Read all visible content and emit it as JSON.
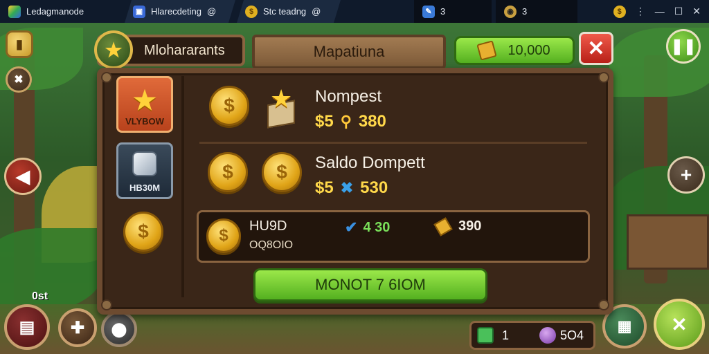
{
  "window": {
    "app_title": "Ledagmanode",
    "tabs": [
      {
        "label": "Hlarecdeting",
        "badge": "@"
      },
      {
        "label": "Stc teadng",
        "badge": "@"
      }
    ],
    "counters": [
      {
        "value": "3"
      },
      {
        "value": "3"
      }
    ]
  },
  "panel": {
    "header_label": "Mlohararants",
    "title": "Mapatiuna",
    "currency_value": "10,000"
  },
  "sidebar": {
    "items": [
      {
        "label": "VLYBOW"
      },
      {
        "label": "HB30M"
      }
    ]
  },
  "offers": [
    {
      "name": "Nompest",
      "price": "$5",
      "amount": "380"
    },
    {
      "name": "Saldo Dompett",
      "price": "$5",
      "amount": "530"
    }
  ],
  "summary": {
    "title": "HU9D",
    "subtitle": "OQ8OIO",
    "value_a": "4 30",
    "value_b": "390"
  },
  "main_button": "MONOT 7 6IOM",
  "bottom_bar": {
    "left_value": "1",
    "right_value": "5O4"
  },
  "left_corner_label": "0st",
  "colors": {
    "accent_green": "#54b020",
    "gold": "#ffd84a",
    "close_red": "#d8302a",
    "wood": "#6d4b30"
  },
  "icons": [
    "star-icon",
    "gem-icon",
    "coin-icon",
    "close-icon",
    "pause-icon",
    "back-arrow-icon",
    "plus-icon",
    "map-icon",
    "gear-icon",
    "crown-icon"
  ]
}
